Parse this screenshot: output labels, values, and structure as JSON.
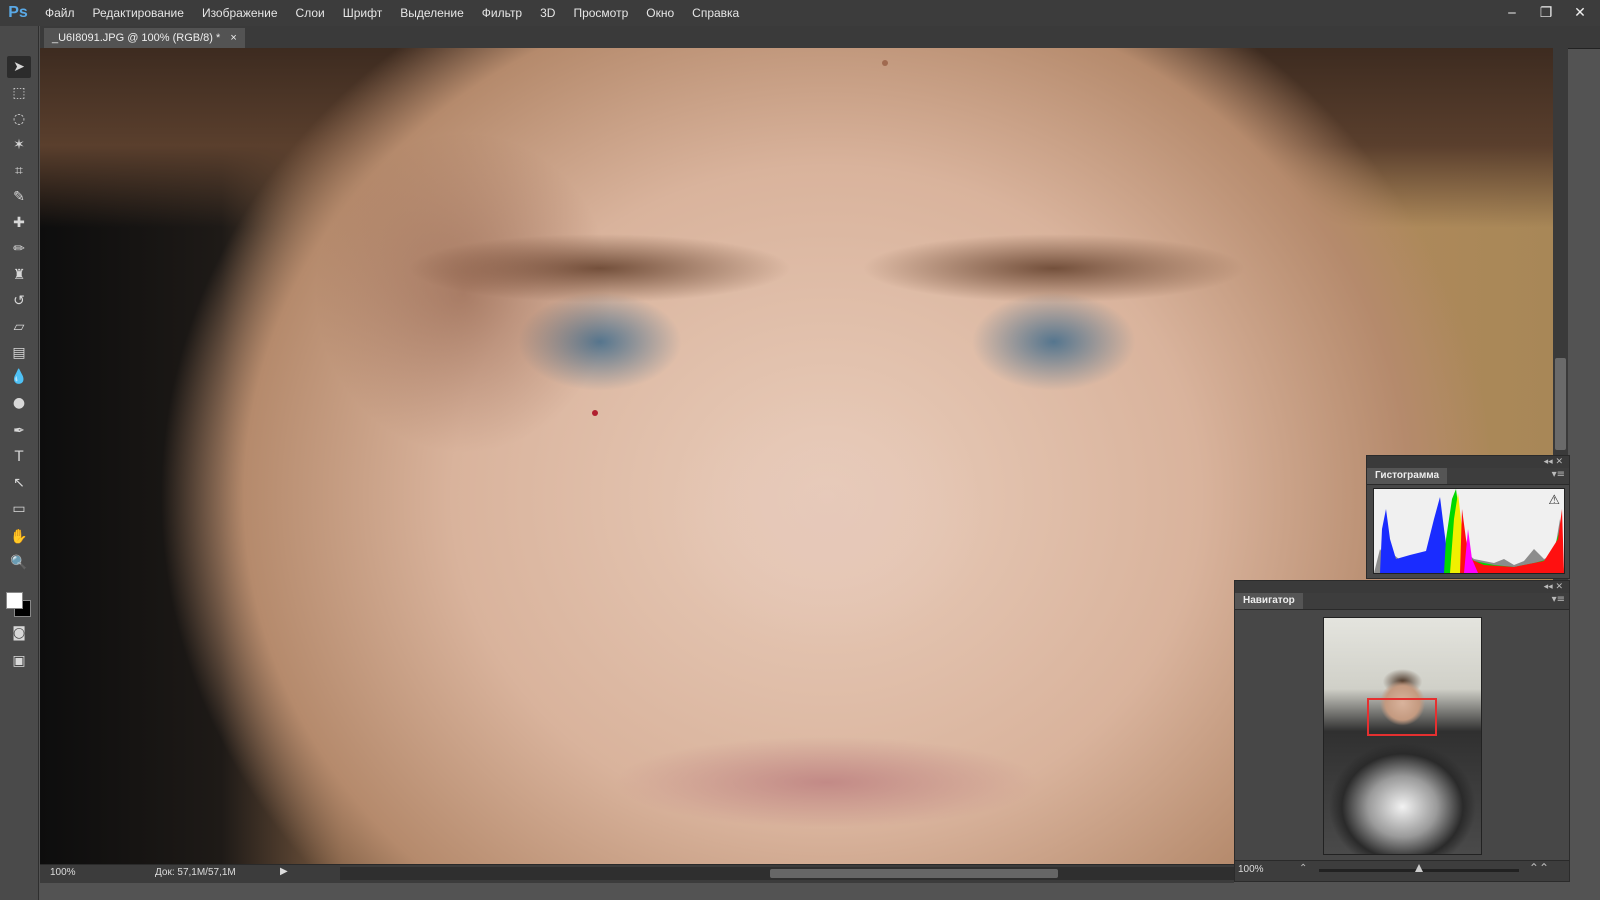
{
  "app": {
    "logo": "Ps"
  },
  "menu": [
    "Файл",
    "Редактирование",
    "Изображение",
    "Слои",
    "Шрифт",
    "Выделение",
    "Фильтр",
    "3D",
    "Просмотр",
    "Окно",
    "Справка"
  ],
  "window_controls": {
    "minimize": "‒",
    "restore": "❐",
    "close": "✕"
  },
  "document": {
    "tab_title": "_U6I8091.JPG @ 100% (RGB/8) *",
    "tab_close": "×"
  },
  "status": {
    "zoom": "100%",
    "doc_size": "Док: 57,1M/57,1M",
    "arrow": "▶"
  },
  "histogram": {
    "title": "Гистограмма",
    "panel_controls": "◂◂ ✕",
    "menu": "▾≡",
    "warning": "⚠"
  },
  "navigator": {
    "title": "Навигатор",
    "panel_controls": "◂◂ ✕",
    "menu": "▾≡",
    "zoom": "100%",
    "minus": "⌃",
    "plus": "⌃⌃"
  },
  "tools": [
    {
      "name": "move-tool-icon",
      "glyph": "➤"
    },
    {
      "name": "marquee-tool-icon",
      "glyph": "⬚"
    },
    {
      "name": "lasso-tool-icon",
      "glyph": "◌"
    },
    {
      "name": "magic-wand-tool-icon",
      "glyph": "✶"
    },
    {
      "name": "crop-tool-icon",
      "glyph": "⌗"
    },
    {
      "name": "eyedropper-tool-icon",
      "glyph": "✎"
    },
    {
      "name": "healing-brush-tool-icon",
      "glyph": "✚"
    },
    {
      "name": "brush-tool-icon",
      "glyph": "✏"
    },
    {
      "name": "clone-stamp-tool-icon",
      "glyph": "♜"
    },
    {
      "name": "history-brush-tool-icon",
      "glyph": "↺"
    },
    {
      "name": "eraser-tool-icon",
      "glyph": "▱"
    },
    {
      "name": "gradient-tool-icon",
      "glyph": "▤"
    },
    {
      "name": "blur-tool-icon",
      "glyph": "💧"
    },
    {
      "name": "dodge-tool-icon",
      "glyph": "●"
    },
    {
      "name": "pen-tool-icon",
      "glyph": "✒"
    },
    {
      "name": "type-tool-icon",
      "glyph": "T"
    },
    {
      "name": "path-selection-tool-icon",
      "glyph": "↖"
    },
    {
      "name": "rectangle-tool-icon",
      "glyph": "▭"
    },
    {
      "name": "hand-tool-icon",
      "glyph": "✋"
    },
    {
      "name": "zoom-tool-icon",
      "glyph": "🔍"
    }
  ],
  "colors": {
    "foreground": "#ffffff",
    "background": "#000000",
    "accent": "#e53030"
  }
}
